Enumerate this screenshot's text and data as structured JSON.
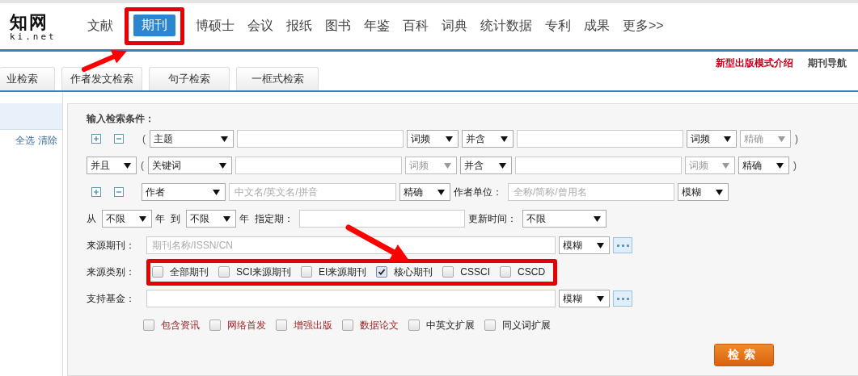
{
  "logo": {
    "name": "知网",
    "domain": "ki.net"
  },
  "nav": [
    {
      "label": "文献",
      "selected": false
    },
    {
      "label": "期刊",
      "selected": true
    },
    {
      "label": "博硕士",
      "selected": false
    },
    {
      "label": "会议",
      "selected": false
    },
    {
      "label": "报纸",
      "selected": false
    },
    {
      "label": "图书",
      "selected": false
    },
    {
      "label": "年鉴",
      "selected": false
    },
    {
      "label": "百科",
      "selected": false
    },
    {
      "label": "词典",
      "selected": false
    },
    {
      "label": "统计数据",
      "selected": false
    },
    {
      "label": "专利",
      "selected": false
    },
    {
      "label": "成果",
      "selected": false
    },
    {
      "label": "更多>>",
      "selected": false
    }
  ],
  "search_tabs": [
    "业检索",
    "作者发文检索",
    "句子检索",
    "一框式检索"
  ],
  "links": [
    {
      "label": "新型出版模式介绍",
      "kind": "highlight"
    },
    {
      "label": "期刊导航",
      "kind": "plain"
    }
  ],
  "sidebar": {
    "actions": [
      "全选",
      "清除"
    ]
  },
  "form": {
    "title": "输入检索条件：",
    "conditions": [
      {
        "open": "(",
        "field": {
          "value": "主题",
          "disabled": false
        },
        "freq": {
          "value": "词频",
          "disabled": false
        },
        "relation": {
          "value": "并含",
          "disabled": false
        },
        "freq2": {
          "value": "词频",
          "disabled": false
        },
        "match": {
          "value": "精确",
          "disabled": true
        },
        "close": ")"
      },
      {
        "logic": {
          "value": "并且",
          "disabled": false
        },
        "open": "(",
        "field": {
          "value": "关键词",
          "disabled": false
        },
        "freq": {
          "value": "词频",
          "disabled": true
        },
        "relation": {
          "value": "并含",
          "disabled": false
        },
        "freq2": {
          "value": "词频",
          "disabled": true
        },
        "match": {
          "value": "精确",
          "disabled": false
        },
        "close": ")"
      }
    ],
    "author": {
      "field": {
        "value": "作者",
        "disabled": false
      },
      "placeholder": "中文名/英文名/拼音",
      "match": {
        "value": "精确",
        "disabled": false
      },
      "unit_label": "作者单位：",
      "unit_placeholder": "全称/简称/曾用名",
      "unit_match": {
        "value": "模糊",
        "disabled": false
      }
    },
    "dates": {
      "from_label": "从",
      "from": {
        "value": "不限",
        "disabled": false
      },
      "from_unit": "年",
      "to_label": "到",
      "to": {
        "value": "不限",
        "disabled": false
      },
      "to_unit": "年",
      "period_label": "指定期：",
      "update_label": "更新时间：",
      "update": {
        "value": "不限",
        "disabled": false
      }
    },
    "source": {
      "label": "来源期刊：",
      "placeholder": "期刊名称/ISSN/CN",
      "match": {
        "value": "模糊",
        "disabled": false
      }
    },
    "category": {
      "label": "来源类别：",
      "highlighted": true,
      "items": [
        {
          "label": "全部期刊",
          "checked": false
        },
        {
          "label": "SCI来源期刊",
          "checked": false
        },
        {
          "label": "EI来源期刊",
          "checked": false
        },
        {
          "label": "核心期刊",
          "checked": true
        },
        {
          "label": "CSSCI",
          "checked": false
        },
        {
          "label": "CSCD",
          "checked": false
        }
      ]
    },
    "fund": {
      "label": "支持基金：",
      "match": {
        "value": "模糊",
        "disabled": false
      }
    },
    "options": [
      {
        "label": "包含资讯",
        "checked": false,
        "kind": "feature"
      },
      {
        "label": "网络首发",
        "checked": false,
        "kind": "feature"
      },
      {
        "label": "增强出版",
        "checked": false,
        "kind": "feature"
      },
      {
        "label": "数据论文",
        "checked": false,
        "kind": "feature"
      },
      {
        "label": "中英文扩展",
        "checked": false,
        "kind": "extension"
      },
      {
        "label": "同义词扩展",
        "checked": false,
        "kind": "extension"
      }
    ],
    "submit": "检索"
  }
}
